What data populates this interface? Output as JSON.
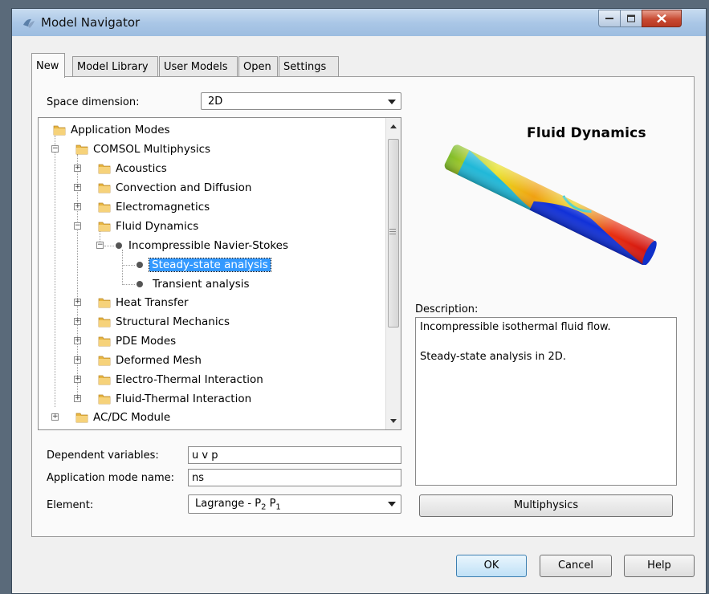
{
  "window": {
    "title": "Model Navigator"
  },
  "tabs": [
    {
      "label": "New",
      "active": true
    },
    {
      "label": "Model Library",
      "active": false
    },
    {
      "label": "User Models",
      "active": false
    },
    {
      "label": "Open",
      "active": false
    },
    {
      "label": "Settings",
      "active": false
    }
  ],
  "space_dimension": {
    "label": "Space dimension:",
    "value": "2D"
  },
  "tree": {
    "items": [
      {
        "label": "Application Modes"
      },
      {
        "label": "COMSOL Multiphysics"
      },
      {
        "label": "Acoustics"
      },
      {
        "label": "Convection and Diffusion"
      },
      {
        "label": "Electromagnetics"
      },
      {
        "label": "Fluid Dynamics"
      },
      {
        "label": "Incompressible Navier-Stokes"
      },
      {
        "label": "Steady-state analysis",
        "selected": true
      },
      {
        "label": "Transient analysis"
      },
      {
        "label": "Heat Transfer"
      },
      {
        "label": "Structural Mechanics"
      },
      {
        "label": "PDE Modes"
      },
      {
        "label": "Deformed Mesh"
      },
      {
        "label": "Electro-Thermal Interaction"
      },
      {
        "label": "Fluid-Thermal Interaction"
      },
      {
        "label": "AC/DC Module"
      }
    ]
  },
  "preview": {
    "title": "Fluid Dynamics"
  },
  "description": {
    "label": "Description:",
    "line1": "Incompressible isothermal fluid flow.",
    "line2": "Steady-state analysis in 2D."
  },
  "fields": {
    "dependent_variables_label": "Dependent variables:",
    "dependent_variables_value": "u v p",
    "app_mode_name_label": "Application mode name:",
    "app_mode_name_value": "ns",
    "element_label": "Element:",
    "element_value_main": "Lagrange - P",
    "element_sub1": "2",
    "element_mid": " P",
    "element_sub2": "1"
  },
  "buttons": {
    "multiphysics": "Multiphysics",
    "ok": "OK",
    "cancel": "Cancel",
    "help": "Help"
  },
  "colors": {
    "selection": "#3399ff",
    "titlebar": "#a9c6e6",
    "close_button": "#c84a32"
  }
}
